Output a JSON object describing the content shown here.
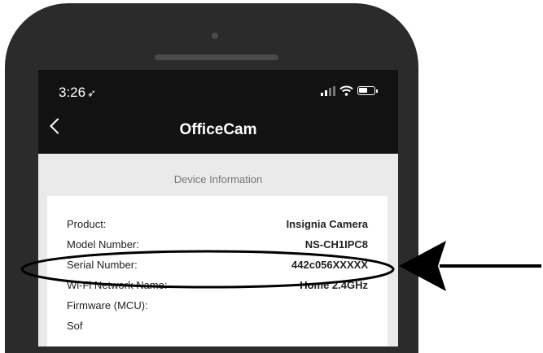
{
  "status_bar": {
    "time": "3:26",
    "location_glyph": "➶"
  },
  "nav": {
    "title": "OfficeCam"
  },
  "section": {
    "header": "Device Information"
  },
  "rows": [
    {
      "label": "Product:",
      "value": "Insignia Camera"
    },
    {
      "label": "Model Number:",
      "value": "NS-CH1IPC8"
    },
    {
      "label": "Serial Number:",
      "value": "442c056XXXXX"
    },
    {
      "label": "Wi-Fi Network Name:",
      "value": "Home 2.4GHz"
    },
    {
      "label": "Firmware (MCU):",
      "value": ""
    },
    {
      "label": "Sof",
      "value": ""
    }
  ],
  "icons": [
    "location-arrow-icon",
    "cellular-signal-icon",
    "wifi-icon",
    "battery-icon",
    "back-chevron-icon",
    "pointer-arrow-icon"
  ],
  "colors": {
    "phone_body": "#2b2b2b",
    "screen_bg": "#121212",
    "content_bg": "#eaeaea",
    "annotation": "#000000"
  }
}
